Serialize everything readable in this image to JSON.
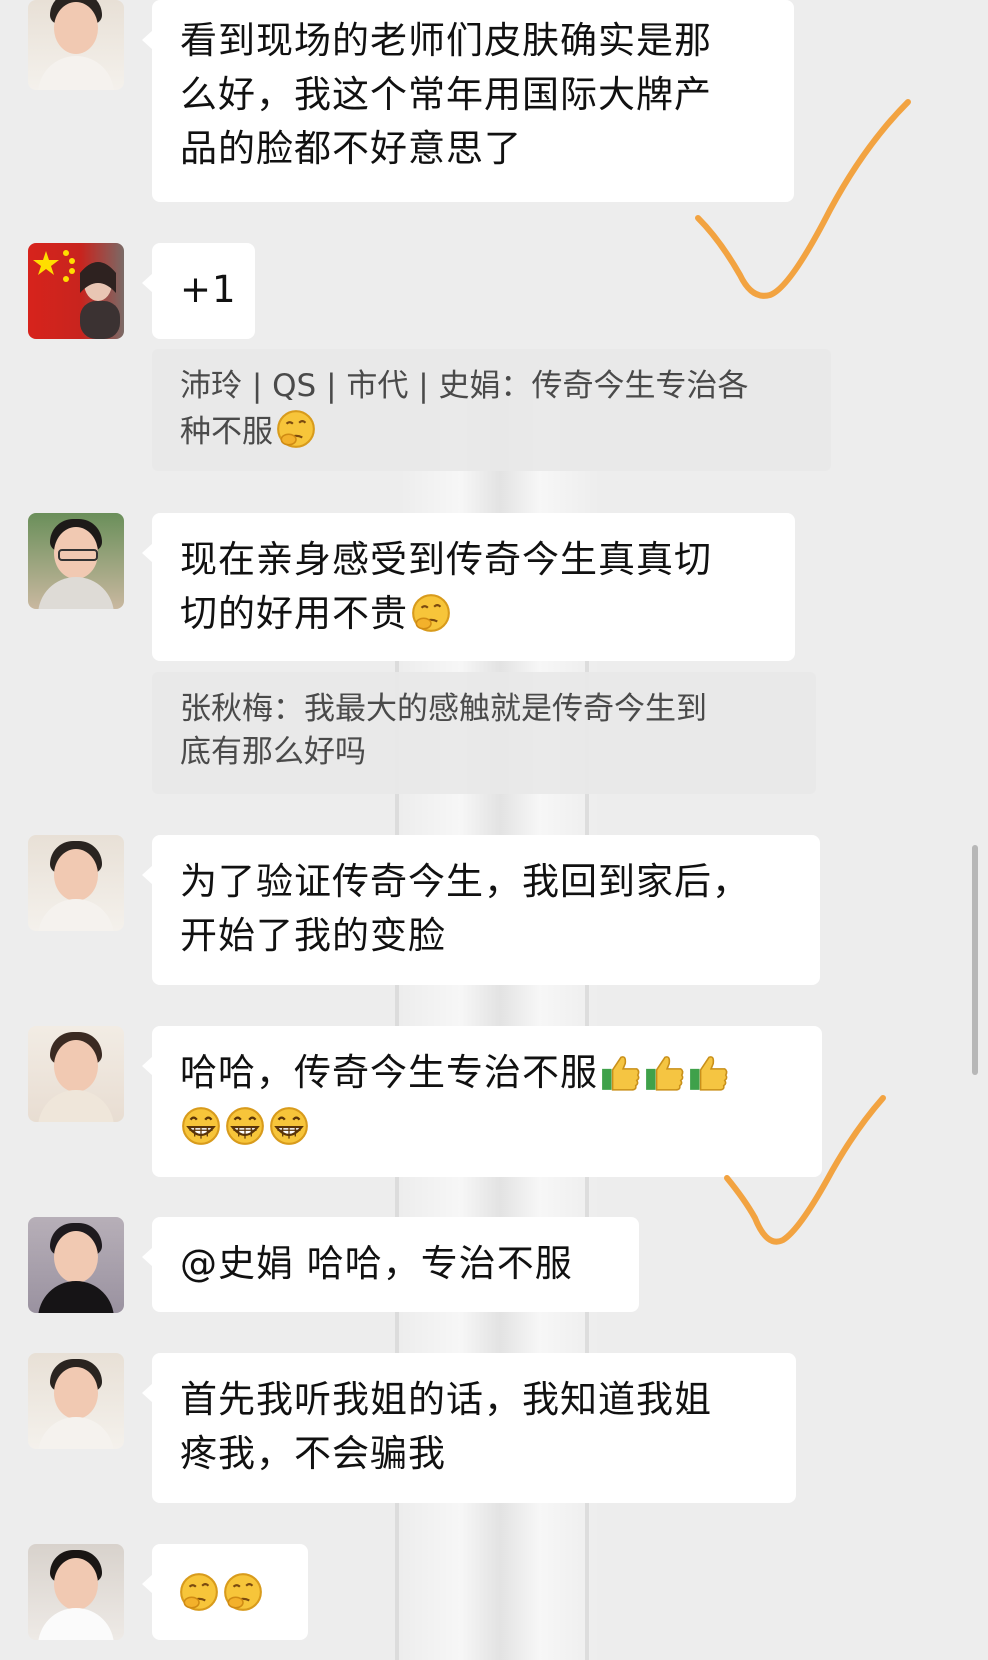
{
  "messages": [
    {
      "text": "看到现场的老师们皮肤确实是那么好，我这个常年用国际大牌产品的脸都不好意思了",
      "lines": [
        "看到现场的老师们皮肤确实是那",
        "么好，我这个常年用国际大牌产",
        "品的脸都不好意思了"
      ],
      "avatar": "woman-fur-collar-avatar"
    },
    {
      "text": "+1",
      "avatar": "chinese-flag-avatar"
    },
    {
      "quote": "沛玲 | QS | 市代 | 史娟：传奇今生专治各种不服",
      "quote_lines": [
        "沛玲 | QS | 市代 | 史娟：传奇今生专治各",
        "种不服"
      ],
      "quote_emoji": "thinking-face"
    },
    {
      "text": "现在亲身感受到传奇今生真真切切的好用不贵",
      "lines": [
        "现在亲身感受到传奇今生真真切",
        "切的好用不贵"
      ],
      "emoji": "thinking-face",
      "avatar": "woman-glasses-avatar"
    },
    {
      "quote": "张秋梅：我最大的感触就是传奇今生到底有那么好吗",
      "quote_lines": [
        "张秋梅：我最大的感触就是传奇今生到",
        "底有那么好吗"
      ]
    },
    {
      "text": "为了验证传奇今生，我回到家后，开始了我的变脸",
      "lines": [
        "为了验证传奇今生，我回到家后，",
        "开始了我的变脸"
      ],
      "avatar": "woman-fur-collar-avatar"
    },
    {
      "text": "哈哈，传奇今生专治不服",
      "lines": [
        "哈哈，传奇今生专治不服"
      ],
      "emojis": [
        "thumbs-up",
        "thumbs-up",
        "thumbs-up",
        "grinning-face",
        "grinning-face",
        "grinning-face"
      ],
      "avatar": "woman-pose-avatar"
    },
    {
      "text": "@史娟 哈哈，专治不服",
      "avatar": "woman-black-dress-avatar"
    },
    {
      "text": "首先我听我姐的话，我知道我姐疼我，不会骗我",
      "lines": [
        "首先我听我姐的话，我知道我姐",
        "疼我，不会骗我"
      ],
      "avatar": "woman-fur-collar-avatar"
    },
    {
      "text": "",
      "emojis": [
        "thinking-face",
        "thinking-face"
      ],
      "avatar": "woman-white-top-avatar"
    }
  ],
  "colors": {
    "background": "#ededed",
    "bubble": "#ffffff",
    "quote_bg": "#e8e8e8",
    "check": "#f2a341"
  }
}
